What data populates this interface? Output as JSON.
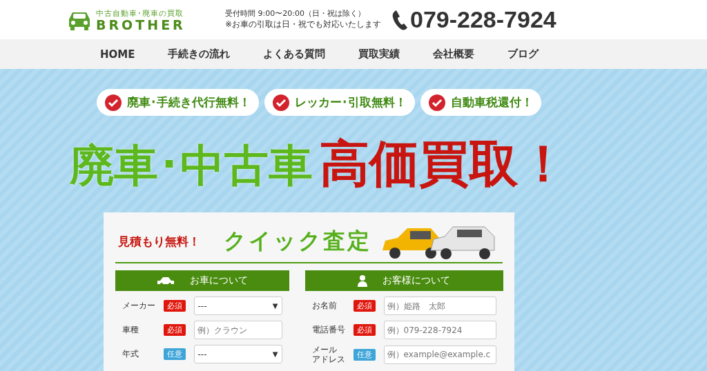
{
  "header": {
    "logo": {
      "tagline": "中古自動車･廃車の買取",
      "name": "BROTHER"
    },
    "hours": "受付時間  9:00〜20:00（日・祝は除く）",
    "note": "※お車の引取は日・祝でも対応いたします",
    "phone": "079-228-7924"
  },
  "nav": [
    "HOME",
    "手続きの流れ",
    "よくある質問",
    "買取実績",
    "会社概要",
    "ブログ"
  ],
  "hero": {
    "badges": [
      "廃車･手続き代行無料！",
      "レッカー･引取無料！",
      "自動車税還付！"
    ],
    "headline_green": "廃車･中古車",
    "headline_red": "高価買取！"
  },
  "form": {
    "free_label": "見積もり無料！",
    "title": "クイック査定",
    "sections": [
      {
        "kind": "car",
        "title": "お車について",
        "fields": [
          {
            "label": [
              "メーカー"
            ],
            "required": true,
            "badge": "必須",
            "kind": "select",
            "value": "---",
            "arrow": "▼"
          },
          {
            "label": [
              "車種"
            ],
            "required": true,
            "badge": "必須",
            "kind": "input",
            "placeholder": "例）クラウン"
          },
          {
            "label": [
              "年式"
            ],
            "required": false,
            "badge": "任意",
            "kind": "select",
            "value": "---",
            "arrow": "▼"
          }
        ]
      },
      {
        "kind": "person",
        "title": "お客様について",
        "fields": [
          {
            "label": [
              "お名前"
            ],
            "required": true,
            "badge": "必須",
            "kind": "input",
            "placeholder": "例）姫路　太郎"
          },
          {
            "label": [
              "電話番号"
            ],
            "required": true,
            "badge": "必須",
            "kind": "input",
            "placeholder": "例）079-228-7924"
          },
          {
            "label": [
              "メール",
              "アドレス"
            ],
            "required": false,
            "badge": "任意",
            "kind": "input",
            "placeholder": "例）example@example.c"
          }
        ]
      }
    ]
  }
}
